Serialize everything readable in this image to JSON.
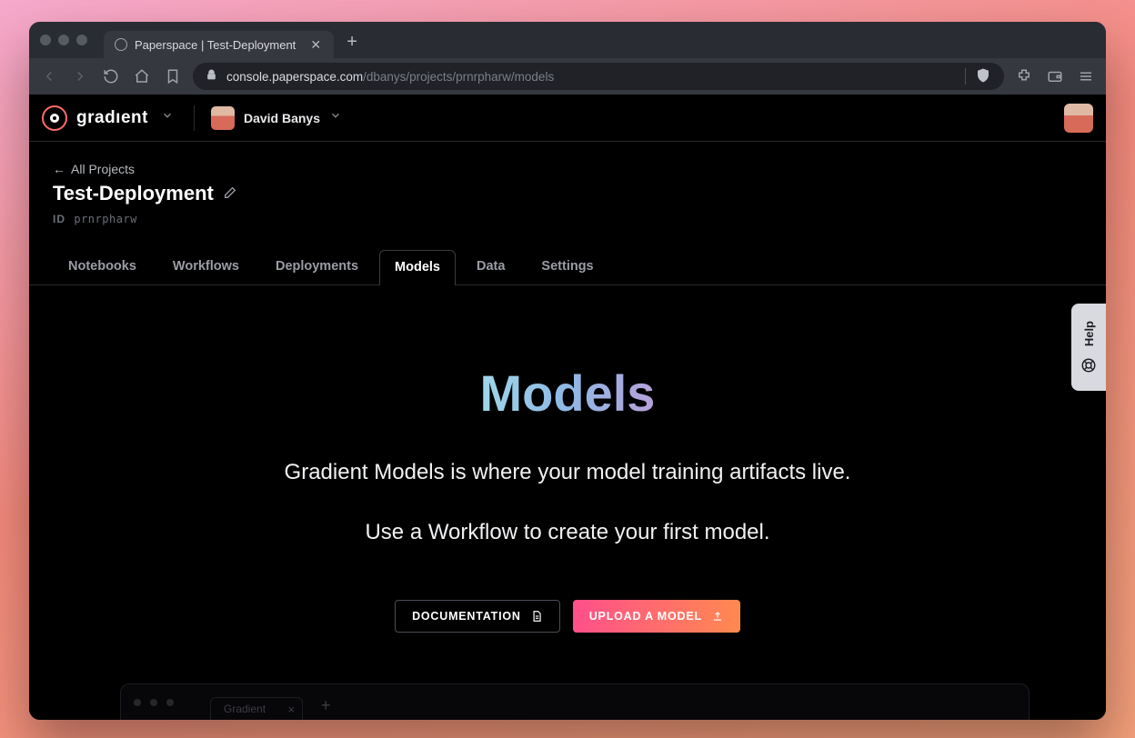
{
  "browser": {
    "tab_title": "Paperspace | Test-Deployment",
    "url_host": "console.paperspace.com",
    "url_path": "/dbanys/projects/prnrpharw/models"
  },
  "header": {
    "brand": "gradıent",
    "user_name": "David Banys"
  },
  "project": {
    "back_label": "All Projects",
    "title": "Test-Deployment",
    "id_label": "ID",
    "id_value": "prnrpharw"
  },
  "tabs": [
    {
      "label": "Notebooks"
    },
    {
      "label": "Workflows"
    },
    {
      "label": "Deployments"
    },
    {
      "label": "Models",
      "active": true
    },
    {
      "label": "Data"
    },
    {
      "label": "Settings"
    }
  ],
  "hero": {
    "title": "Models",
    "subtitle": "Gradient Models is where your model training artifacts live.",
    "subtitle2": "Use a Workflow to create your first model.",
    "doc_button": "DOCUMENTATION",
    "upload_button": "UPLOAD A MODEL"
  },
  "help_tab": "Help",
  "ghost_tab": "Gradient"
}
